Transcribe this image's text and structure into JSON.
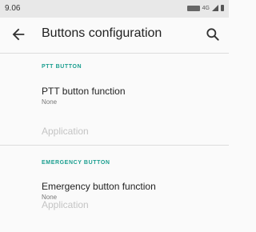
{
  "status_bar": {
    "time": "9.06",
    "network": "4G",
    "icons": [
      "nfc-card-icon",
      "data-icon",
      "signal-icon",
      "battery-icon"
    ]
  },
  "app_bar": {
    "title": "Buttons configuration",
    "back_icon": "arrow-left-icon",
    "search_icon": "search-icon"
  },
  "sections": [
    {
      "header": "PTT BUTTON",
      "function_title": "PTT button function",
      "function_value": "None",
      "application_label": "Application"
    },
    {
      "header": "EMERGENCY BUTTON",
      "function_title": "Emergency button function",
      "function_value": "None",
      "application_label": "Application"
    }
  ],
  "colors": {
    "accent": "#1a9e8f",
    "disabled_text": "#c4c4c4",
    "background": "#fafafa",
    "status_bar": "#e8e8e8"
  }
}
